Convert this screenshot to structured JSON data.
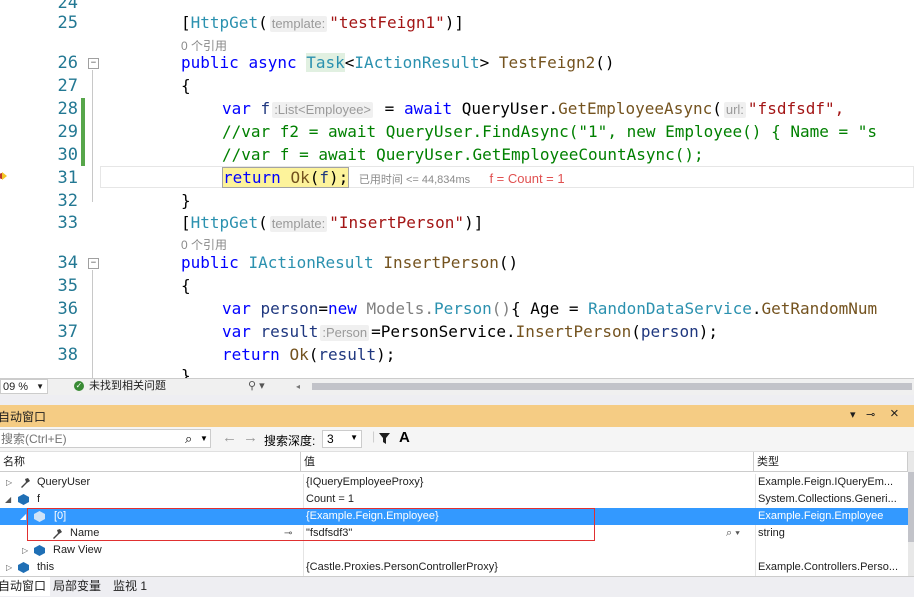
{
  "editor": {
    "line_numbers": [
      "24",
      "25",
      "26",
      "27",
      "28",
      "29",
      "30",
      "31",
      "32",
      "33",
      "34",
      "35",
      "36",
      "37",
      "38"
    ],
    "codelens": [
      "0 个引用",
      "0 个引用"
    ],
    "lines": {
      "l25": {
        "attr": "HttpGet",
        "hint": "template:",
        "str": "\"testFeign1\""
      },
      "l26": {
        "kw1": "public",
        "kw2": "async",
        "type1": "Task",
        "type2": "IActionResult",
        "method": "TestFeign2",
        "punct": "()"
      },
      "l27": {
        "text": "{"
      },
      "l28": {
        "kw": "var",
        "var": "f",
        "hint": ":List<Employee>",
        "eq": " = ",
        "kw2": "await",
        "obj": "QueryUser",
        "method": "GetEmployeeAsync",
        "hint2": "url:",
        "str": "\"fsdfsdf\","
      },
      "l29": {
        "comment": "//var f2 = await QueryUser.FindAsync(\"1\", new Employee() { Name = \"s"
      },
      "l30": {
        "comment": "//var f = await QueryUser.GetEmployeeCountAsync();"
      },
      "l31": {
        "kw": "return",
        "method": "Ok",
        "arg": "f",
        "perf": "已用时间 <= 44,834ms",
        "datatip": "f = Count = 1"
      },
      "l32": {
        "text": "}"
      },
      "l33": {
        "attr": "HttpGet",
        "hint": "template:",
        "str": "\"InsertPerson\""
      },
      "l34": {
        "kw": "public",
        "type": "IActionResult",
        "method": "InsertPerson",
        "punct": "()"
      },
      "l35": {
        "text": "{"
      },
      "l36": {
        "kw": "var",
        "var": "person",
        "kw2": "new",
        "ns": "Models",
        "type": "Person",
        "prop": "Age",
        "cls": "RandonDataService",
        "method": "GetRandomNum"
      },
      "l37": {
        "kw": "var",
        "var": "result",
        "hint": ":Person",
        "cls": "PersonService",
        "method": "InsertPerson",
        "arg": "person"
      },
      "l38": {
        "kw": "return",
        "method": "Ok",
        "arg": "result"
      }
    }
  },
  "statusbar": {
    "zoom": "09 %",
    "issues": "未找到相关问题"
  },
  "autos": {
    "title": "自动窗口",
    "search_placeholder": "搜索(Ctrl+E)",
    "search_depth_label": "搜索深度:",
    "search_depth_value": "3",
    "columns": [
      "名称",
      "值",
      "类型"
    ],
    "rows": [
      {
        "name": "QueryUser",
        "value": "{IQueryEmployeeProxy}",
        "type": "Example.Feign.IQueryEm..."
      },
      {
        "name": "f",
        "value": "Count = 1",
        "type": "System.Collections.Generi..."
      },
      {
        "name": "[0]",
        "value": "{Example.Feign.Employee}",
        "type": "Example.Feign.Employee"
      },
      {
        "name": "Name",
        "value": "\"fsdfsdf3\"",
        "type": "string"
      },
      {
        "name": "Raw View",
        "value": "",
        "type": ""
      },
      {
        "name": "this",
        "value": "{Castle.Proxies.PersonControllerProxy}",
        "type": "Example.Controllers.Perso..."
      }
    ]
  },
  "tabs": [
    "自动窗口",
    "局部变量",
    "监视 1"
  ],
  "colors": {
    "selection": "#3399ff",
    "title_bar": "#f5cc84",
    "highlight_box": "#e03030",
    "modified_bar": "#57a64a"
  }
}
